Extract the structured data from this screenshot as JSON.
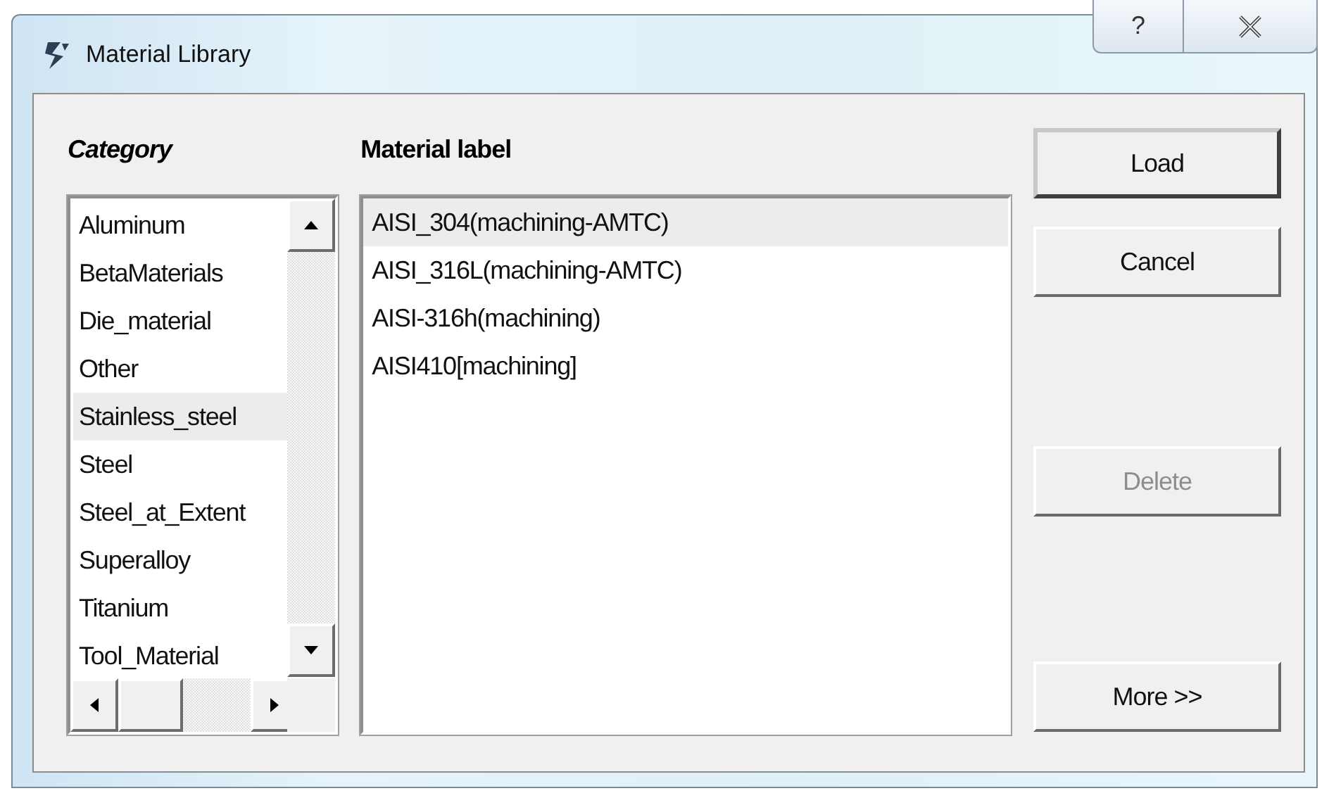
{
  "window": {
    "title": "Material Library",
    "controls": [
      {
        "kind": "help",
        "label": "?"
      },
      {
        "kind": "close"
      }
    ]
  },
  "category": {
    "heading": "Category",
    "items": [
      {
        "label": "Aluminum",
        "selected": false
      },
      {
        "label": "BetaMaterials",
        "selected": false
      },
      {
        "label": "Die_material",
        "selected": false
      },
      {
        "label": "Other",
        "selected": false
      },
      {
        "label": "Stainless_steel",
        "selected": true
      },
      {
        "label": "Steel",
        "selected": false
      },
      {
        "label": "Steel_at_Extent",
        "selected": false
      },
      {
        "label": "Superalloy",
        "selected": false
      },
      {
        "label": "Titanium",
        "selected": false
      },
      {
        "label": "Tool_Material",
        "selected": false
      }
    ]
  },
  "materials": {
    "heading": "Material label",
    "items": [
      {
        "label": "AISI_304(machining-AMTC)",
        "selected": true
      },
      {
        "label": "AISI_316L(machining-AMTC)",
        "selected": false
      },
      {
        "label": "AISI-316h(machining)",
        "selected": false
      },
      {
        "label": "AISI410[machining]",
        "selected": false
      }
    ]
  },
  "buttons": [
    {
      "label": "Load",
      "default": true,
      "disabled": false
    },
    {
      "label": "Cancel",
      "default": false,
      "disabled": false
    },
    {
      "label": "Delete",
      "default": false,
      "disabled": true
    },
    {
      "label": "More >>",
      "default": false,
      "disabled": false
    }
  ]
}
